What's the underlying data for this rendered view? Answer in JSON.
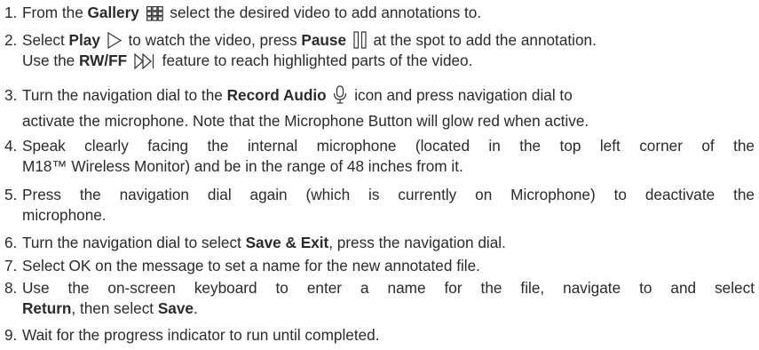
{
  "steps": [
    {
      "n": "1.",
      "parts": [
        "From the ",
        "Gallery",
        " select the desired video to add annotations to."
      ]
    },
    {
      "n": "2.",
      "parts": [
        "Select ",
        "Play",
        " to watch the video, press ",
        "Pause",
        " at the spot to add the annotation."
      ],
      "line2": [
        "Use the ",
        "RW/FF",
        " feature to reach highlighted parts of the video."
      ]
    },
    {
      "n": "3.",
      "parts": [
        "Turn the navigation dial to the ",
        "Record Audio",
        " icon and press navigation dial to"
      ],
      "line2": [
        "activate the microphone. Note that the Microphone Button will glow red when active."
      ]
    },
    {
      "n": "4.",
      "line1": "Speak clearly facing the internal microphone (located in the top left corner of the",
      "line2": "M18™ Wireless Monitor) and be in the range of 48 inches from it."
    },
    {
      "n": "5.",
      "line1": "Press the navigation dial again (which is currently on Microphone) to deactivate the",
      "line2": "microphone."
    },
    {
      "n": "6.",
      "parts": [
        "Turn the navigation dial to select ",
        "Save & Exit",
        ", press the navigation dial."
      ]
    },
    {
      "n": "7.",
      "line1": "Select OK on the message to set a name for the new annotated file."
    },
    {
      "n": "8.",
      "line1": "Use the on-screen keyboard to enter a name for the file, navigate to and select",
      "parts2": [
        "Return",
        ", then select ",
        "Save",
        "."
      ]
    },
    {
      "n": "9.",
      "line1": "Wait for the progress indicator to run until completed."
    }
  ],
  "icons": {
    "gallery": "grid-icon",
    "play": "play-icon",
    "pause": "pause-icon",
    "rwff": "fast-forward-icon",
    "mic": "microphone-icon"
  }
}
